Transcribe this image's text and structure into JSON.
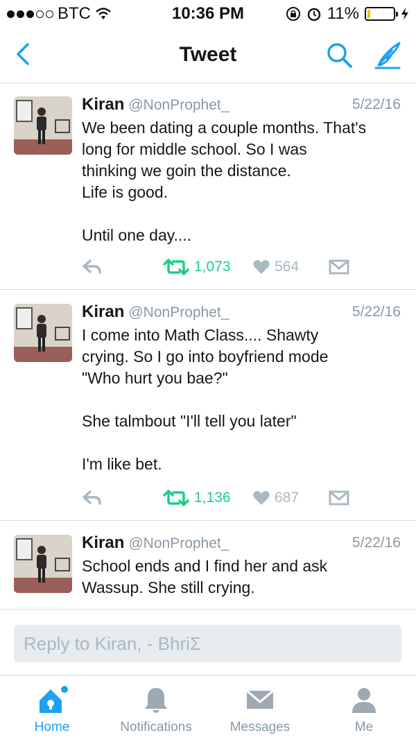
{
  "status_bar": {
    "carrier": "BTC",
    "time": "10:36 PM",
    "battery": "11%",
    "battery_fraction": 0.11,
    "icons": [
      "signal-dots-icon",
      "wifi-icon",
      "orientation-lock-icon",
      "alarm-icon",
      "battery-icon",
      "charging-icon"
    ]
  },
  "nav": {
    "title": "Tweet",
    "icons": [
      "back-chevron-icon",
      "search-icon",
      "compose-icon"
    ],
    "accent": "#1da1f2"
  },
  "tweets": [
    {
      "name": "Kiran",
      "handle": "@NonProphet_",
      "date": "5/22/16",
      "text": "We been dating a couple months. That's\nlong for middle school. So I was\nthinking we goin the distance.\nLife is good.\n\nUntil one day....",
      "retweets": "1,073",
      "likes": "564"
    },
    {
      "name": "Kiran",
      "handle": "@NonProphet_",
      "date": "5/22/16",
      "text": "I come into Math Class.... Shawty\ncrying. So I go into boyfriend mode\n\"Who hurt you bae?\"\n\nShe talmbout \"I'll tell you later\"\n\nI'm like bet.",
      "retweets": "1,136",
      "likes": "687"
    },
    {
      "name": "Kiran",
      "handle": "@NonProphet_",
      "date": "5/22/16",
      "text": "School ends and I find her and ask\nWassup. She still crying."
    }
  ],
  "reply": {
    "placeholder": "Reply to Kiran, - BhriΣ"
  },
  "tabs": [
    {
      "label": "Home",
      "icon": "home-icon",
      "active": true
    },
    {
      "label": "Notifications",
      "icon": "bell-icon",
      "active": false
    },
    {
      "label": "Messages",
      "icon": "envelope-icon",
      "active": false
    },
    {
      "label": "Me",
      "icon": "person-icon",
      "active": false
    }
  ],
  "colors": {
    "retweet": "#19cf86",
    "muted": "#8899a6",
    "accent": "#1da1f2"
  }
}
